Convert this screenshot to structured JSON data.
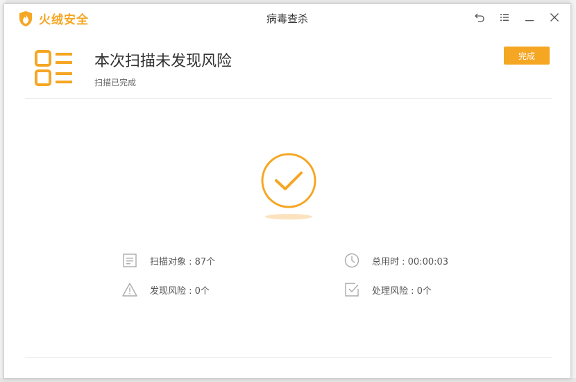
{
  "app": {
    "brand_name": "火绒安全",
    "window_title": "病毒查杀"
  },
  "colors": {
    "accent": "#f5a623",
    "text_dark": "#333333",
    "text_muted": "#666666"
  },
  "window_controls": [
    "back-icon",
    "menu-icon",
    "minimize-icon",
    "close-icon"
  ],
  "header": {
    "icon": "list-icon",
    "title": "本次扫描未发现风险",
    "subtitle": "扫描已完成",
    "done_label": "完成"
  },
  "result": {
    "icon": "checkmark-circle-icon"
  },
  "stats": [
    {
      "icon": "document-icon",
      "text": "扫描对象 : 87个"
    },
    {
      "icon": "clock-icon",
      "text": "总用时 : 00:00:03"
    },
    {
      "icon": "warning-icon",
      "text": "发现风险 : 0个"
    },
    {
      "icon": "checkbox-icon",
      "text": "处理风险 : 0个"
    }
  ]
}
